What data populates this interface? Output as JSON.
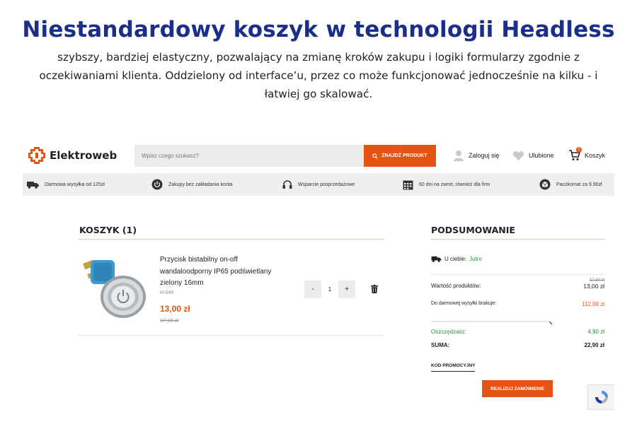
{
  "hero": {
    "title": "Niestandardowy koszyk w technologii Headless",
    "subtitle_line1": "szybszy, bardziej elastyczny, pozwalający na zmianę kroków zakupu i logiki formularzy zgodnie z",
    "subtitle_line2": "oczekiwaniami klienta. Oddzielony od interface’u, przez co może funkcjonować jednocześnie na kilku - i",
    "subtitle_line3": "łatwiej go skalować."
  },
  "header": {
    "logo_text": "Elektroweb",
    "search_placeholder": "Wpisz czego szukasz?",
    "search_button": "ZNAJDŹ PRODUKT",
    "login": "Zaloguj się",
    "favorites": "Ulubione",
    "cart": "Koszyk",
    "cart_count": "1"
  },
  "benefits": [
    {
      "label": "Darmowa wysyłka od 125zł",
      "icon": "truck-icon"
    },
    {
      "label": "Zakupy bez zakładania konta",
      "icon": "power-icon"
    },
    {
      "label": "Wsparcie posprzedażowe",
      "icon": "headset-icon"
    },
    {
      "label": "60 dni na zwrot, również dla firm",
      "icon": "calendar-icon"
    },
    {
      "label": "Paczkomat za 9.90zł",
      "icon": "parcel-icon"
    }
  ],
  "cart": {
    "title": "KOSZYK (1)",
    "item": {
      "name_line1": "Przycisk bistabilny on-off",
      "name_line2": "wandaloodporny IP65 podświetlany",
      "name_line3": "zielony 16mm",
      "sku": "H-049",
      "price": "13,00 zł",
      "old_price": "17,90 zł",
      "quantity": "1",
      "minus": "-",
      "plus": "+"
    }
  },
  "summary": {
    "title": "PODSUMOWANIE",
    "delivery_label": "U ciebie:",
    "delivery_value": "Jutro",
    "products_label": "Wartość produktów:",
    "products_old": "17,90 zł",
    "products_value": "13,00 zł",
    "free_shipping_label": "Do darmowej wysyłki brakuje:",
    "free_shipping_value": "112,00 zł",
    "free_shipping_progress": 0.104,
    "savings_label": "Oszczędzasz:",
    "savings_value": "4,90 zł",
    "total_label": "SUMA:",
    "total_value": "22,90 zł",
    "promo_code": "KOD PROMOCYJNY",
    "order_button": "REALIZUJ ZAMÓWIENIE"
  },
  "colors": {
    "accent": "#e65414",
    "title_blue": "#1a2e8a",
    "green": "#2a8c3a"
  }
}
